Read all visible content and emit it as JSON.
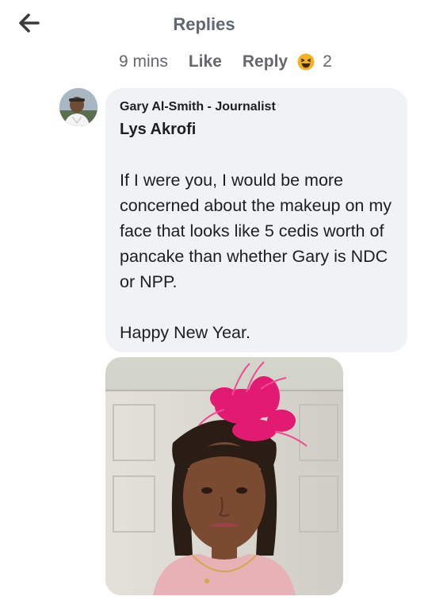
{
  "header": {
    "title": "Replies",
    "back_icon": "back-arrow-icon"
  },
  "reply_meta": {
    "time": "9 mins",
    "like_label": "Like",
    "reply_label": "Reply",
    "reaction_icon": "haha-reaction-icon",
    "reaction_count": "2"
  },
  "comment": {
    "author": "Gary Al-Smith - Journalist",
    "tagged_name": "Lys Akrofi",
    "paragraphs": [
      "If I were you, I would be more concerned about the makeup on my face that looks like 5 cedis worth of pancake than whether Gary is NDC or NPP.",
      "Happy New Year."
    ],
    "photo_icon": "attached-photo"
  },
  "colors": {
    "bubble": "#f0f2f5",
    "meta_text": "#65676b",
    "reaction": "#f7b125"
  }
}
